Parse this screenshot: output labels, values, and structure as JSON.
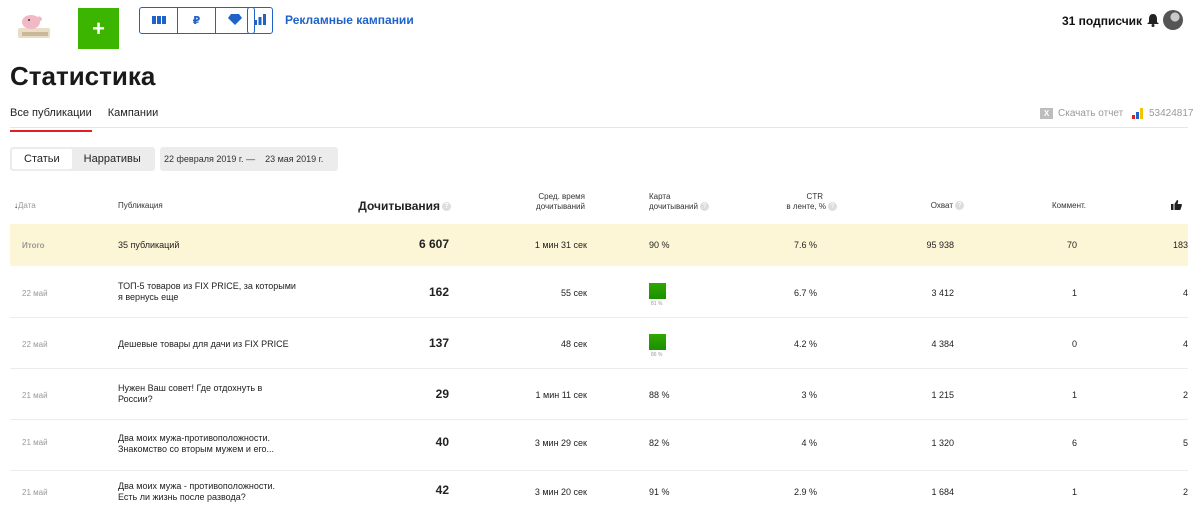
{
  "topbar": {
    "add_label": "+",
    "ad_campaigns": "Рекламные кампании",
    "subscribers": "31 подписчик",
    "tool_ruble": "₽"
  },
  "page": {
    "title": "Статистика"
  },
  "tabs": [
    {
      "label": "Все публикации",
      "active": true
    },
    {
      "label": "Кампании",
      "active": false
    }
  ],
  "report": {
    "download_label": "Скачать отчет",
    "xl_icon": "X",
    "metrika_id": "53424817"
  },
  "filters": {
    "segments": [
      {
        "label": "Статьи",
        "active": true
      },
      {
        "label": "Нарративы",
        "active": false
      }
    ],
    "date_from": "22 февраля 2019 г.",
    "date_sep": "—",
    "date_to": "23 мая 2019 г."
  },
  "table": {
    "headers": {
      "date": "Дата",
      "publication": "Публикация",
      "reads": "Дочитывания",
      "avg_time_1": "Сред. время",
      "avg_time_2": "дочитываний",
      "map_1": "Карта",
      "map_2": "дочитываний",
      "ctr_1": "CTR",
      "ctr_2": "в ленте, %",
      "reach": "Охват",
      "comments": "Коммент.",
      "help": "?"
    },
    "total": {
      "date": "Итого",
      "publication": "35 публикаций",
      "reads": "6 607",
      "time": "1 мин 31 сек",
      "map": "90 %",
      "ctr": "7.6 %",
      "reach": "95 938",
      "comments": "70",
      "likes": "183"
    },
    "rows": [
      {
        "date": "22 май",
        "publication": "ТОП-5 товаров из FIX PRICE, за которыми я вернусь еще",
        "reads": "162",
        "time": "55 сек",
        "map_pct": "81 %",
        "map_bar": true,
        "ctr": "6.7 %",
        "reach": "3 412",
        "comments": "1",
        "likes": "4"
      },
      {
        "date": "22 май",
        "publication": "Дешевые товары для дачи из FIX PRICE",
        "reads": "137",
        "time": "48 сек",
        "map_pct": "86 %",
        "map_bar": true,
        "ctr": "4.2 %",
        "reach": "4 384",
        "comments": "0",
        "likes": "4"
      },
      {
        "date": "21 май",
        "publication": "Нужен Ваш совет! Где отдохнуть в России?",
        "reads": "29",
        "time": "1 мин 11 сек",
        "map": "88 %",
        "ctr": "3 %",
        "reach": "1 215",
        "comments": "1",
        "likes": "2"
      },
      {
        "date": "21 май",
        "publication": "Два моих мужа-противоположности. Знакомство со вторым мужем и его...",
        "reads": "40",
        "time": "3 мин 29 сек",
        "map": "82 %",
        "ctr": "4 %",
        "reach": "1 320",
        "comments": "6",
        "likes": "5"
      },
      {
        "date": "21 май",
        "publication": "Два моих мужа - противоположности. Есть ли жизнь после развода?",
        "reads": "42",
        "time": "3 мин 20 сек",
        "map": "91 %",
        "ctr": "2.9 %",
        "reach": "1 684",
        "comments": "1",
        "likes": "2"
      }
    ]
  },
  "colors": {
    "accent_blue": "#1f63c9",
    "add_green": "#3cb500",
    "tab_red": "#e21f24",
    "total_bg": "#fdf6d6",
    "map_green": "#30a800"
  }
}
